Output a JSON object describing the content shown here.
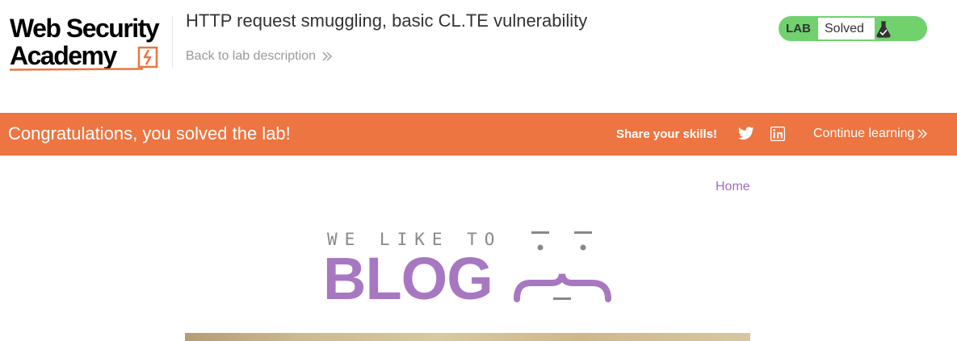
{
  "header": {
    "logo": {
      "line1": "Web Security",
      "line2": "Academy"
    },
    "lab_title": "HTTP request smuggling, basic CL.TE vulnerability",
    "back_link": "Back to lab description",
    "status": {
      "label": "LAB",
      "value": "Solved",
      "icon": "flask-icon"
    }
  },
  "banner": {
    "message": "Congratulations, you solved the lab!",
    "share_label": "Share your skills!",
    "share_icons": [
      "twitter-icon",
      "linkedin-icon"
    ],
    "continue_label": "Continue learning"
  },
  "blog": {
    "nav": {
      "home": "Home"
    },
    "logo": {
      "tagline": "WE LIKE TO",
      "word": "BLOG"
    }
  },
  "colors": {
    "brand_orange": "#ed7541",
    "solved_green": "#70d16d",
    "blog_purple": "#a877c2",
    "link_purple": "#a06fc0"
  }
}
